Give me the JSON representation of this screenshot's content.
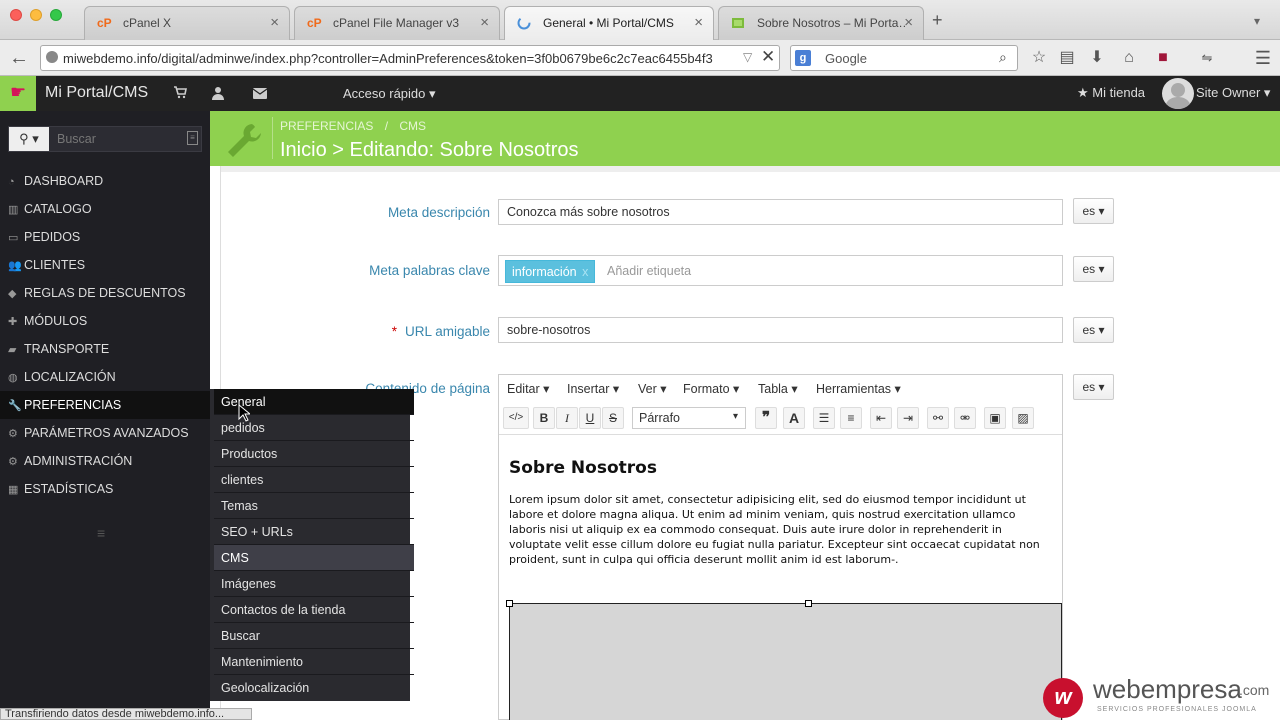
{
  "browser": {
    "tabs": [
      {
        "icon": "cP",
        "label": "cPanel X",
        "close": "×"
      },
      {
        "icon": "cP",
        "label": "cPanel File Manager v3",
        "close": "×"
      },
      {
        "icon": "",
        "label": "General • Mi Portal/CMS",
        "close": "×"
      },
      {
        "icon": "",
        "label": "Sobre Nosotros – Mi Porta…",
        "close": "×"
      }
    ],
    "new_tab": "+",
    "url": "miwebdemo.info/digital/adminwe/index.php?controller=AdminPreferences&token=3f0b0679be6c2c7eac6455b4f3",
    "search_placeholder": "Google",
    "status_text": "Transfiriendo datos desde miwebdemo.info..."
  },
  "app": {
    "title": "Mi Portal/CMS",
    "quick_access": "Acceso rápido",
    "store": "Mi tienda",
    "user": "Site Owner"
  },
  "sidebar": {
    "search_placeholder": "Buscar",
    "items": [
      {
        "icon": "dashboard-icon",
        "label": "DASHBOARD"
      },
      {
        "icon": "book-icon",
        "label": "CATALOGO"
      },
      {
        "icon": "credit-card-icon",
        "label": "PEDIDOS"
      },
      {
        "icon": "users-icon",
        "label": "CLIENTES"
      },
      {
        "icon": "tags-icon",
        "label": "REGLAS DE DESCUENTOS"
      },
      {
        "icon": "puzzle-icon",
        "label": "MÓDULOS"
      },
      {
        "icon": "truck-icon",
        "label": "TRANSPORTE"
      },
      {
        "icon": "globe-icon",
        "label": "LOCALIZACIÓN"
      },
      {
        "icon": "wrench-icon",
        "label": "PREFERENCIAS"
      },
      {
        "icon": "cogs-icon",
        "label": "PARÁMETROS AVANZADOS"
      },
      {
        "icon": "cog-icon",
        "label": "ADMINISTRACIÓN"
      },
      {
        "icon": "bar-chart-icon",
        "label": "ESTADÍSTICAS"
      }
    ],
    "submenu": [
      "General",
      "pedidos",
      "Productos",
      "clientes",
      "Temas",
      "SEO + URLs",
      "CMS",
      "Imágenes",
      "Contactos de la tienda",
      "Buscar",
      "Mantenimiento",
      "Geolocalización"
    ]
  },
  "header": {
    "breadcrumb_1": "PREFERENCIAS",
    "breadcrumb_sep": "/",
    "breadcrumb_2": "CMS",
    "title": "Inicio > Editando: Sobre Nosotros"
  },
  "form": {
    "meta_desc_label": "Meta descripción",
    "meta_desc_value": "Conozca más sobre nosotros",
    "meta_keywords_label": "Meta palabras clave",
    "keyword_tag": "información",
    "keyword_remove": "x",
    "keyword_placeholder": "Añadir etiqueta",
    "url_label": "URL amigable",
    "required_mark": "*",
    "url_value": "sobre-nosotros",
    "content_label": "Contenido de página",
    "lang": "es"
  },
  "editor": {
    "menus": [
      "Editar",
      "Insertar",
      "Ver",
      "Formato",
      "Tabla",
      "Herramientas"
    ],
    "format_select": "Párrafo",
    "heading": "Sobre Nosotros",
    "body": "Lorem ipsum dolor sit amet, consectetur adipisicing elit, sed do eiusmod tempor incididunt ut labore et dolore magna aliqua. Ut enim ad minim veniam, quis nostrud exercitation ullamco laboris nisi ut aliquip ex ea commodo consequat. Duis aute irure dolor in reprehenderit in voluptate velit esse cillum dolore eu fugiat nulla pariatur. Excepteur sint occaecat cupidatat non proident, sunt in culpa qui officia deserunt mollit anim id est laborum-."
  },
  "watermark": {
    "brand": "webempresa",
    "suffix": ".com",
    "tagline": "SERVICIOS PROFESIONALES JOOMLA"
  },
  "colors": {
    "accent_green": "#8fd14f",
    "link_blue": "#3a87ad",
    "sidebar_bg": "#1f1f24"
  }
}
